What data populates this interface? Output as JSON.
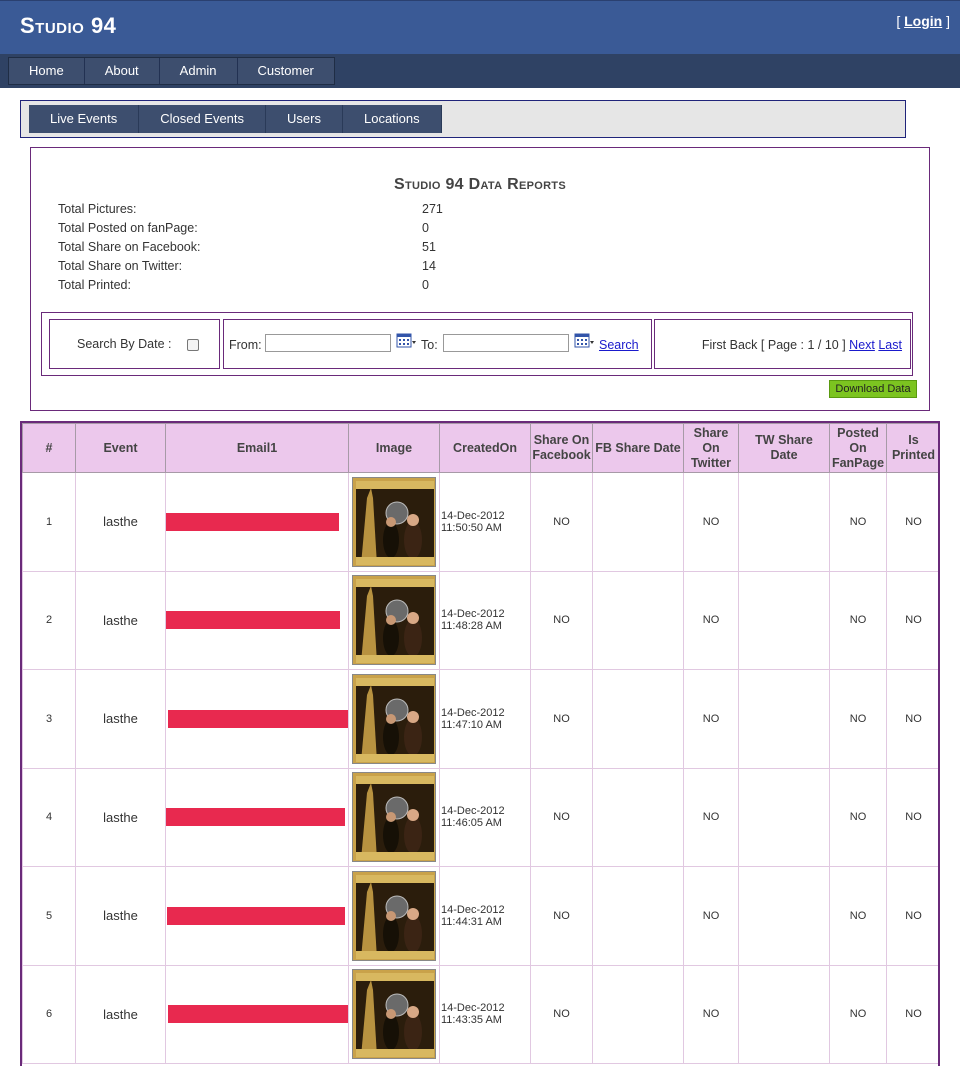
{
  "brand": {
    "name": "Studio 94"
  },
  "header": {
    "login_left": "[ ",
    "login": "Login",
    "login_right": " ]"
  },
  "main_nav": {
    "items": [
      {
        "label": "Home"
      },
      {
        "label": "About"
      },
      {
        "label": "Admin"
      },
      {
        "label": "Customer"
      }
    ]
  },
  "sub_nav": {
    "items": [
      {
        "label": "Live Events"
      },
      {
        "label": "Closed Events"
      },
      {
        "label": "Users"
      },
      {
        "label": "Locations"
      }
    ]
  },
  "report": {
    "title": "Studio 94 Data Reports",
    "stats": [
      {
        "label": "Total Pictures:",
        "value": "271"
      },
      {
        "label": "Total Posted on fanPage:",
        "value": "0"
      },
      {
        "label": "Total Share on Facebook:",
        "value": "51"
      },
      {
        "label": "Total Share on Twitter:",
        "value": "14"
      },
      {
        "label": "Total Printed:",
        "value": "0"
      }
    ],
    "search_by_date_label": "Search By Date :",
    "from_label": "From:",
    "to_label": "To:",
    "search_label": "Search",
    "pager": {
      "first": "First",
      "back": "Back",
      "page_text": "[ Page : 1 / 10 ]",
      "next": "Next",
      "last": "Last"
    },
    "download_label": "Download Data"
  },
  "table": {
    "columns": [
      "#",
      "Event",
      "Email1",
      "Image",
      "CreatedOn",
      "Share On Facebook",
      "FB Share Date",
      "Share On Twitter",
      "TW Share Date",
      "Posted On FanPage",
      "Is Printed"
    ],
    "rows": [
      {
        "num": "1",
        "event": "lasthe",
        "created_date": "14-Dec-2012",
        "created_time": "11:50:50 AM",
        "share_fb": "NO",
        "fb_date": "",
        "share_tw": "NO",
        "tw_date": "",
        "posted_fanpage": "NO",
        "is_printed": "NO"
      },
      {
        "num": "2",
        "event": "lasthe",
        "created_date": "14-Dec-2012",
        "created_time": "11:48:28 AM",
        "share_fb": "NO",
        "fb_date": "",
        "share_tw": "NO",
        "tw_date": "",
        "posted_fanpage": "NO",
        "is_printed": "NO"
      },
      {
        "num": "3",
        "event": "lasthe",
        "created_date": "14-Dec-2012",
        "created_time": "11:47:10 AM",
        "share_fb": "NO",
        "fb_date": "",
        "share_tw": "NO",
        "tw_date": "",
        "posted_fanpage": "NO",
        "is_printed": "NO"
      },
      {
        "num": "4",
        "event": "lasthe",
        "created_date": "14-Dec-2012",
        "created_time": "11:46:05 AM",
        "share_fb": "NO",
        "fb_date": "",
        "share_tw": "NO",
        "tw_date": "",
        "posted_fanpage": "NO",
        "is_printed": "NO"
      },
      {
        "num": "5",
        "event": "lasthe",
        "created_date": "14-Dec-2012",
        "created_time": "11:44:31 AM",
        "share_fb": "NO",
        "fb_date": "",
        "share_tw": "NO",
        "tw_date": "",
        "posted_fanpage": "NO",
        "is_printed": "NO"
      },
      {
        "num": "6",
        "event": "lasthe",
        "created_date": "14-Dec-2012",
        "created_time": "11:43:35 AM",
        "share_fb": "NO",
        "fb_date": "",
        "share_tw": "NO",
        "tw_date": "",
        "posted_fanpage": "NO",
        "is_printed": "NO"
      }
    ]
  },
  "colors": {
    "header": "#3a5a96",
    "nav": "#2f4264",
    "table_header": "#ecc8ec",
    "redaction": "#e8294f",
    "download_button": "#7cc420",
    "link": "#1a1acc"
  }
}
